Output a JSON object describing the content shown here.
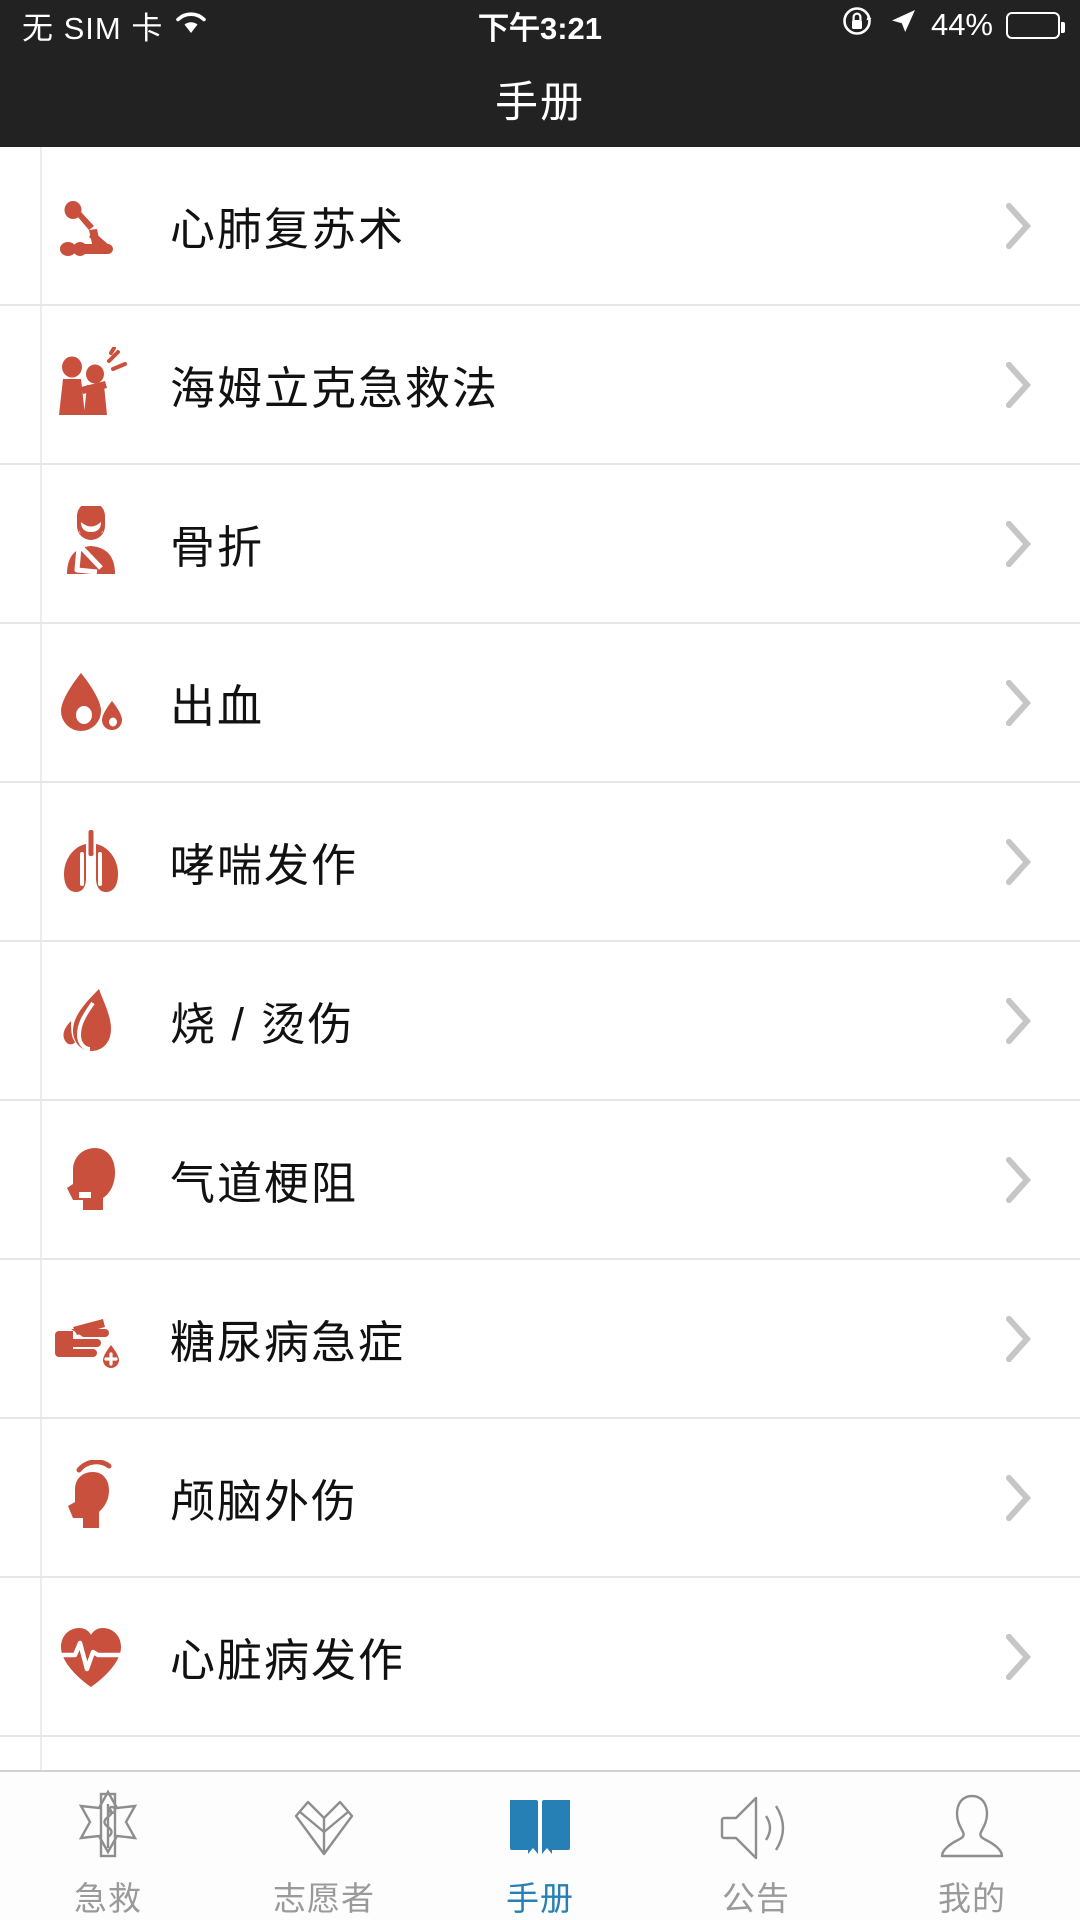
{
  "statusbar": {
    "carrier": "无 SIM 卡",
    "wifi_icon": "wifi-icon",
    "time": "下午3:21",
    "rotation_lock_icon": "rotation-lock-icon",
    "location_icon": "location-arrow-icon",
    "battery_percent": "44%",
    "battery_level": 44,
    "battery_icon": "battery-icon",
    "background_color": "#222222",
    "text_color": "#ffffff"
  },
  "navbar": {
    "title": "手册",
    "background_color": "#222222",
    "text_color": "#ffffff"
  },
  "theme": {
    "accent_red": "#c8503c",
    "active_blue": "#2680b5",
    "inactive_gray": "#9a9a9a",
    "chevron_gray": "#c6c6c8",
    "divider": "#e6e6e6"
  },
  "list": {
    "items": [
      {
        "label": "心肺复苏术",
        "icon": "cpr-icon",
        "chevron_icon": "chevron-right-icon"
      },
      {
        "label": "海姆立克急救法",
        "icon": "heimlich-icon",
        "chevron_icon": "chevron-right-icon"
      },
      {
        "label": "骨折",
        "icon": "arm-sling-icon",
        "chevron_icon": "chevron-right-icon"
      },
      {
        "label": "出血",
        "icon": "blood-drop-icon",
        "chevron_icon": "chevron-right-icon"
      },
      {
        "label": "哮喘发作",
        "icon": "lungs-icon",
        "chevron_icon": "chevron-right-icon"
      },
      {
        "label": "烧 / 烫伤",
        "icon": "flame-icon",
        "chevron_icon": "chevron-right-icon"
      },
      {
        "label": "气道梗阻",
        "icon": "airway-head-icon",
        "chevron_icon": "chevron-right-icon"
      },
      {
        "label": "糖尿病急症",
        "icon": "finger-prick-icon",
        "chevron_icon": "chevron-right-icon"
      },
      {
        "label": "颅脑外伤",
        "icon": "head-trauma-icon",
        "chevron_icon": "chevron-right-icon"
      },
      {
        "label": "心脏病发作",
        "icon": "heart-pulse-icon",
        "chevron_icon": "chevron-right-icon"
      },
      {
        "label": "",
        "icon": "partial-row-icon",
        "chevron_icon": ""
      }
    ]
  },
  "tabbar": {
    "tabs": [
      {
        "label": "急救",
        "icon": "star-of-life-icon",
        "active": false
      },
      {
        "label": "志愿者",
        "icon": "heart-outline-icon",
        "active": false
      },
      {
        "label": "手册",
        "icon": "book-icon",
        "active": true
      },
      {
        "label": "公告",
        "icon": "speaker-icon",
        "active": false
      },
      {
        "label": "我的",
        "icon": "person-icon",
        "active": false
      }
    ]
  }
}
